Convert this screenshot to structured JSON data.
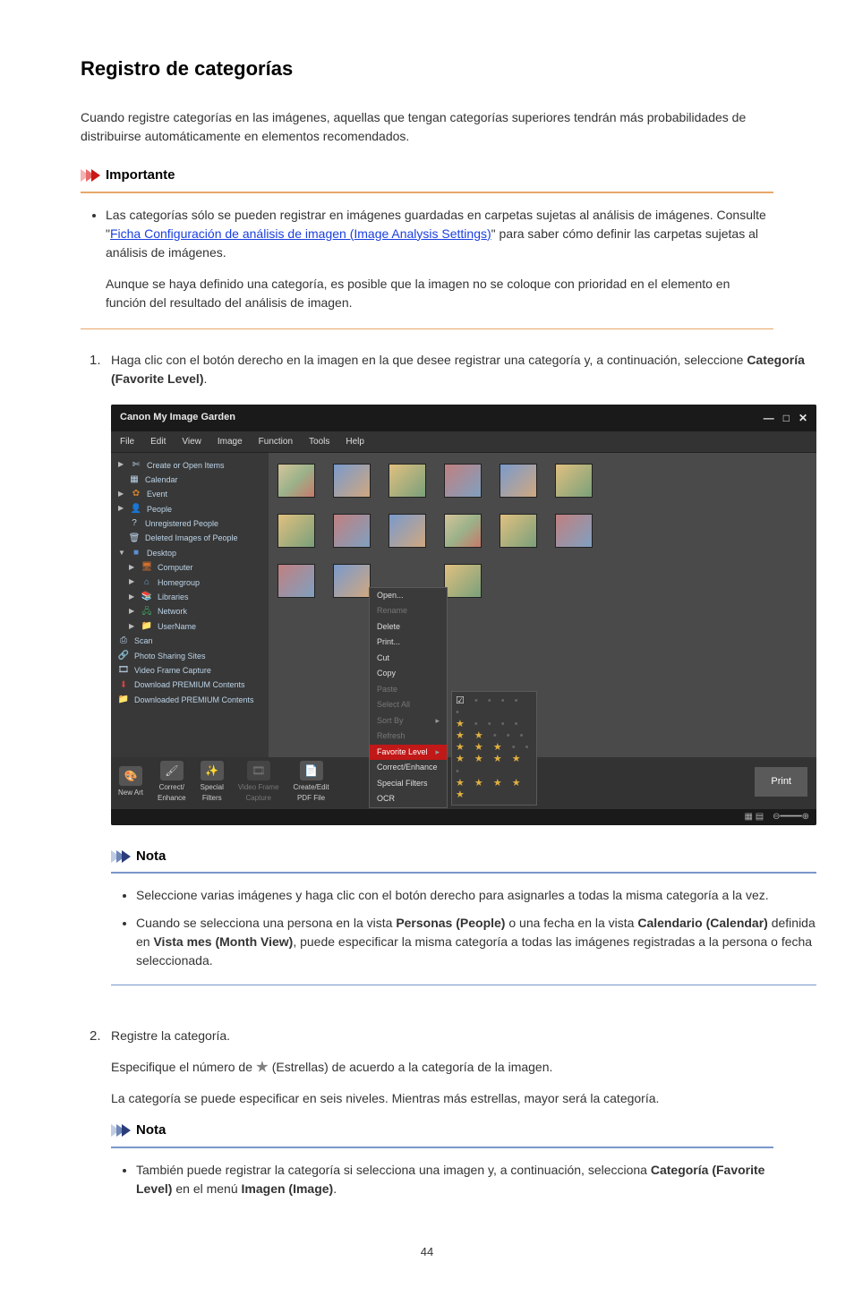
{
  "page_number": "44",
  "heading": "Registro de categorías",
  "intro": "Cuando registre categorías en las imágenes, aquellas que tengan categorías superiores tendrán más probabilidades de distribuirse automáticamente en elementos recomendados.",
  "importante": {
    "title": "Importante",
    "bullet1_pre": "Las categorías sólo se pueden registrar en imágenes guardadas en carpetas sujetas al análisis de imágenes. Consulte \"",
    "bullet1_link": "Ficha Configuración de análisis de imagen (Image Analysis Settings)",
    "bullet1_post": "\" para saber cómo definir las carpetas sujetas al análisis de imágenes.",
    "para2": "Aunque se haya definido una categoría, es posible que la imagen no se coloque con prioridad en el elemento en función del resultado del análisis de imagen."
  },
  "steps": {
    "s1_num": "1.",
    "s1_pre": "Haga clic con el botón derecho en la imagen en la que desee registrar una categoría y, a continuación, seleccione ",
    "s1_bold": "Categoría (Favorite Level)",
    "s1_post": ".",
    "s2_num": "2.",
    "s2_text": "Registre la categoría.",
    "s2_para_pre": "Especifique el número de ",
    "s2_para_post": " (Estrellas) de acuerdo a la categoría de la imagen.",
    "s2_para2": "La categoría se puede especificar en seis niveles. Mientras más estrellas, mayor será la categoría."
  },
  "nota1": {
    "title": "Nota",
    "b1": "Seleccione varias imágenes y haga clic con el botón derecho para asignarles a todas la misma categoría a la vez.",
    "b2_pre": "Cuando se selecciona una persona en la vista ",
    "b2_bold1": "Personas (People)",
    "b2_mid": " o una fecha en la vista ",
    "b2_bold2": "Calendario (Calendar)",
    "b2_mid2": " definida en ",
    "b2_bold3": "Vista mes (Month View)",
    "b2_post": ", puede especificar la misma categoría a todas las imágenes registradas a la persona o fecha seleccionada."
  },
  "nota2": {
    "title": "Nota",
    "b1_pre": "También puede registrar la categoría si selecciona una imagen y, a continuación, selecciona ",
    "b1_bold1": "Categoría (Favorite Level)",
    "b1_mid": " en el menú ",
    "b1_bold2": "Imagen (Image)",
    "b1_post": "."
  },
  "app": {
    "title": "Canon My Image Garden",
    "win_min": "—",
    "win_max": "□",
    "win_close": "✕",
    "menu": {
      "file": "File",
      "edit": "Edit",
      "view": "View",
      "image": "Image",
      "function": "Function",
      "tools": "Tools",
      "help": "Help"
    },
    "sidebar": {
      "create": "Create or Open Items",
      "calendar": "Calendar",
      "event": "Event",
      "people": "People",
      "unreg": "Unregistered People",
      "deleted": "Deleted Images of People",
      "desktop": "Desktop",
      "computer": "Computer",
      "homegroup": "Homegroup",
      "libraries": "Libraries",
      "network": "Network",
      "username": "UserName",
      "scan": "Scan",
      "sharing": "Photo Sharing Sites",
      "video": "Video Frame Capture",
      "dlpremium": "Download PREMIUM Contents",
      "dledpremium": "Downloaded PREMIUM Contents"
    },
    "ctx": {
      "open": "Open...",
      "rename": "Rename",
      "delete": "Delete",
      "print": "Print...",
      "cut": "Cut",
      "copy": "Copy",
      "paste": "Paste",
      "selectall": "Select All",
      "sortby": "Sort By",
      "refresh": "Refresh",
      "favlevel": "Favorite Level",
      "correct": "Correct/Enhance",
      "filters": "Special Filters",
      "ocr": "OCR"
    },
    "bottombar": {
      "newart": "New Art",
      "correct": "Correct/\nEnhance",
      "special": "Special\nFilters",
      "video": "Video Frame\nCapture",
      "pdf": "Create/Edit\nPDF File",
      "print": "Print"
    }
  }
}
